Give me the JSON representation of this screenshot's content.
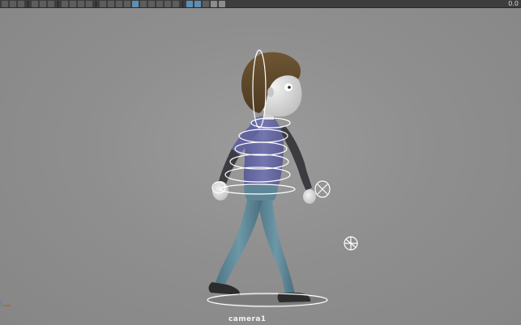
{
  "toolbar": {
    "buttons": [
      "select-tool",
      "lasso-tool",
      "paint-tool",
      "move-tool",
      "rotate-tool",
      "scale-tool",
      "snap-grid",
      "snap-curve",
      "snap-point",
      "history",
      "render",
      "ipr-render",
      "render-settings",
      "hypershade",
      "xray",
      "wireframe",
      "smooth-shade",
      "textured",
      "lighting",
      "shadows",
      "isolate",
      "grid",
      "joints",
      "image-plane"
    ],
    "value_text": "0.0"
  },
  "viewport": {
    "camera_label": "camera1"
  },
  "colors": {
    "background": "#8f8f8f",
    "toolbar": "#3d3d3d",
    "accent": "#5a8fb6",
    "rig_control": "#ffffff"
  },
  "icons": [
    "axis-gizmo-icon"
  ]
}
